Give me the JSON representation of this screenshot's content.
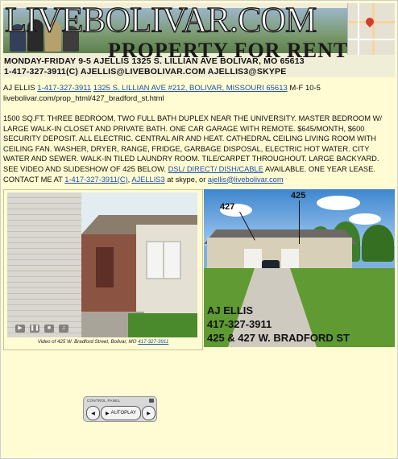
{
  "banner": {
    "brand": "LIVEBOLIVAR.COM",
    "subtitle": "PROPERTY FOR RENT",
    "line1": "MONDAY-FRIDAY 9-5  AJELLIS 1325 S. LILLIAN AVE BOLIVAR, MO 65613",
    "line2": "1-417-327-3911(C)   AJELLIS@LIVEBOLIVAR.COM    AJELLIS3@SKYPE"
  },
  "contact": {
    "name": "AJ ELLIS",
    "phone": "1-417-327-3911",
    "address": "1325 S. LILLIAN AVE #212, BOLIVAR, MISSOURI 65613",
    "hours": "M-F 10-5",
    "url": "livebolivar.com/prop_html/427_bradford_st.html"
  },
  "description": {
    "text1": "1500 SQ.FT. THREE BEDROOM, TWO FULL BATH DUPLEX NEAR THE UNIVERSITY.   MASTER BEDROOM W/ LARGE WALK-IN CLOSET AND PRIVATE BATH.  ONE CAR GARAGE WITH REMOTE.  $645/MONTH, $600 SECURITY DEPOSIT.  ALL ELECTRIC.  CENTRAL AIR AND HEAT.  CATHEDRAL CEILING LIVING ROOM WITH CEILING FAN.   WASHER, DRYER, RANGE, FRIDGE, GARBAGE DISPOSAL, ELECTRIC HOT WATER.  CITY WATER AND SEWER.  WALK-IN TILED LAUNDRY ROOM.  TILE/CARPET THROUGHOUT.  LARGE BACKYARD.  SEE VIDEO AND SLIDESHOW OF 425 BELOW.  ",
    "dish_link": "DSL/ DIRECT/ DISH/CABLE",
    "text2": " AVAILABLE.  ONE YEAR LEASE.  CONTACT ME AT ",
    "phone_link": "1-417-327-3911(C)",
    "sep": ", ",
    "skype_link": "AJELLIS3",
    "text3": " at skype, or ",
    "email_link": "ajellis@livebolivar.com"
  },
  "video": {
    "caption_prefix": "Video of 425 W. Bradford Street, Bolivar, MO ",
    "caption_phone": "417-327-3911"
  },
  "photo": {
    "label_427": "427",
    "label_425": "425",
    "overlay_name": "AJ ELLIS",
    "overlay_phone": "417-327-3911",
    "overlay_address": "425 & 427 W. BRADFORD ST"
  },
  "control_panel": {
    "title": "CONTROL PANEL",
    "autoplay_label": "AUTOPLAY"
  }
}
